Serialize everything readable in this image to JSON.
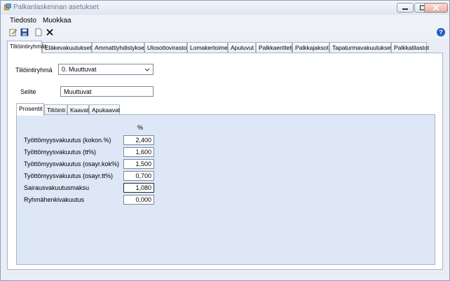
{
  "window": {
    "title": "Palkanlaskennan asetukset"
  },
  "menu": {
    "items": [
      "Tiedosto",
      "Muokkaa"
    ]
  },
  "tabs": [
    "Tiliöintiryhmät",
    "Eläkevakuutukset",
    "Ammattiyhdistykset",
    "Ulosottovirastot",
    "Lomakertoimet",
    "Apuluvut",
    "Palkkaerittely",
    "Palkkajaksot",
    "Tapaturmavakuutukset",
    "Palkkatilastot"
  ],
  "active_tab": "Tiliöintiryhmät",
  "form": {
    "group_label": "Tiliöintiryhmä",
    "group_value": "0. Muuttuvat",
    "selite_label": "Selite",
    "selite_value": "Muuttuvat"
  },
  "subtabs": [
    "Prosentit",
    "Tiliöinti",
    "Kaavat",
    "Apukaavat"
  ],
  "active_subtab": "Prosentit",
  "percent_header": "%",
  "rows": [
    {
      "label": "Työttömyysvakuutus (kokon.%)",
      "value": "2,400"
    },
    {
      "label": "Työttömyysvakuutus (tt%)",
      "value": "1,600"
    },
    {
      "label": "Työttömyysvakuutus (osayr.kok%)",
      "value": "1,500"
    },
    {
      "label": "Työttömyysvakuutus (osayr.tt%)",
      "value": "0,700"
    },
    {
      "label": "Sairausvakuutusmaksu",
      "value": "1,080"
    },
    {
      "label": "Ryhmähenkivakuutus",
      "value": "0,000"
    }
  ],
  "help_symbol": "?"
}
